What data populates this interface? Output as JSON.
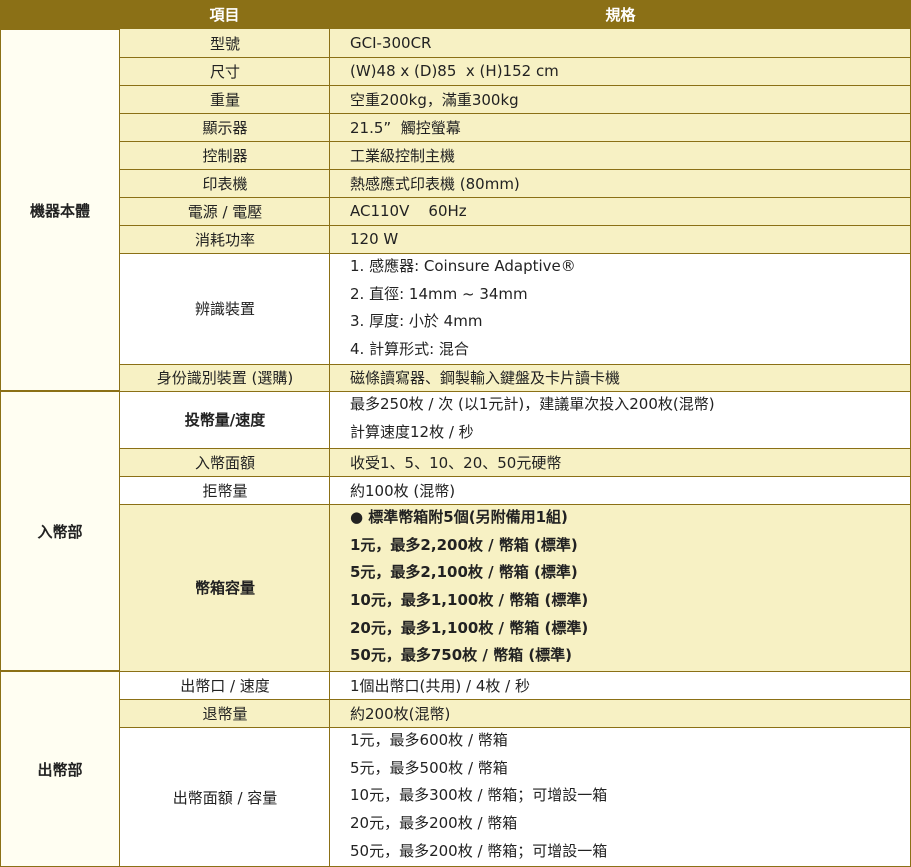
{
  "headers": {
    "item": "項目",
    "spec": "規格"
  },
  "groups": {
    "machine": "機器本體",
    "coin_in": "入幣部",
    "coin_out": "出幣部"
  },
  "machine": {
    "model": {
      "item": "型號",
      "value": "GCI-300CR"
    },
    "size": {
      "item": "尺寸",
      "value": "(W)48 x (D)85  x (H)152 cm"
    },
    "weight": {
      "item": "重量",
      "value": "空重200kg，滿重300kg"
    },
    "display": {
      "item": "顯示器",
      "value": "21.5”  觸控螢幕"
    },
    "controller": {
      "item": "控制器",
      "value": "工業級控制主機"
    },
    "printer": {
      "item": "印表機",
      "value": "熱感應式印表機 (80mm)"
    },
    "power": {
      "item": "電源 / 電壓",
      "value": "AC110V    60Hz"
    },
    "consumption": {
      "item": "消耗功率",
      "value": "120 W"
    },
    "recognition": {
      "item": "辨識裝置",
      "lines": [
        "1. 感應器: Coinsure Adaptive®",
        "2. 直徑: 14mm ~ 34mm",
        "3. 厚度: 小於 4mm",
        "4. 計算形式: 混合"
      ]
    },
    "id_device": {
      "item": "身份識別裝置 (選購)",
      "value": "磁條讀寫器、鋼製輸入鍵盤及卡片讀卡機"
    }
  },
  "coin_in": {
    "speed": {
      "item": "投幣量/速度",
      "lines": [
        "最多250枚 / 次 (以1元計)，建議單次投入200枚(混幣)",
        "計算速度12枚 / 秒"
      ]
    },
    "denomination": {
      "item": "入幣面額",
      "value": "收受1、5、10、20、50元硬幣"
    },
    "reject": {
      "item": "拒幣量",
      "value": "約100枚 (混幣)"
    },
    "box": {
      "item": "幣箱容量",
      "lines": [
        "●  標準幣箱附5個(另附備用1組)",
        "1元，最多2,200枚 / 幣箱 (標準)",
        "5元，最多2,100枚 / 幣箱 (標準)",
        "10元，最多1,100枚 / 幣箱 (標準)",
        "20元，最多1,100枚 / 幣箱 (標準)",
        "50元，最多750枚 / 幣箱 (標準)"
      ]
    }
  },
  "coin_out": {
    "outlet": {
      "item": "出幣口 / 速度",
      "value": "1個出幣口(共用) / 4枚 / 秒"
    },
    "return": {
      "item": "退幣量",
      "value": "約200枚(混幣)"
    },
    "capacity": {
      "item": "出幣面額 / 容量",
      "lines": [
        "1元，最多600枚 / 幣箱",
        "5元，最多500枚 / 幣箱",
        "10元，最多300枚 / 幣箱；可增設一箱",
        "20元，最多200枚 / 幣箱",
        "50元，最多200枚 / 幣箱；可增設一箱"
      ]
    }
  },
  "colors": {
    "header": "#8b7016",
    "highlight": "#f7f1c4",
    "group_bg": "#fffef2"
  }
}
